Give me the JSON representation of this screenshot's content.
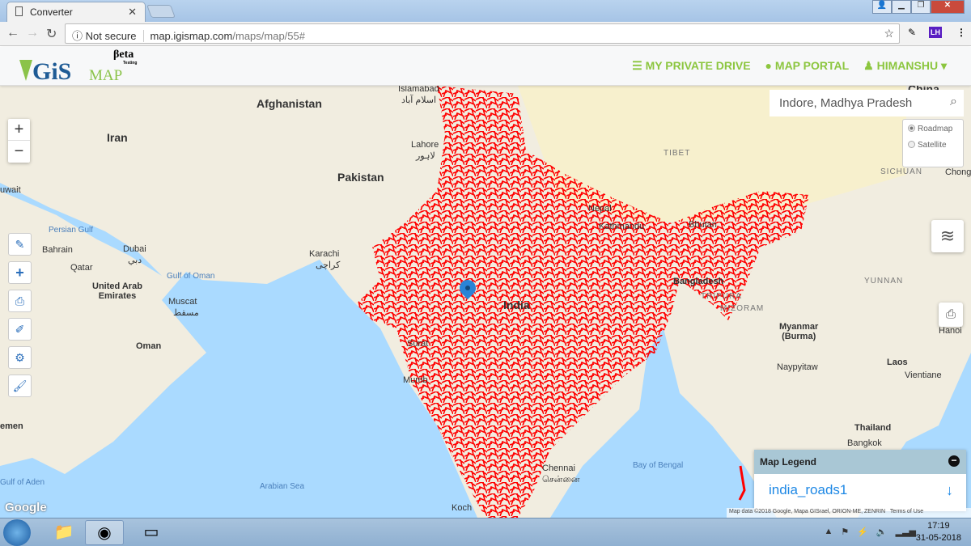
{
  "browser": {
    "tab_title": "Converter",
    "security": "Not secure",
    "url_host": "map.igismap.com",
    "url_path": "/maps/map/55#",
    "ext_badge": "LH"
  },
  "app": {
    "logo": {
      "gis": "GiS",
      "map": "MAP",
      "beta": "βeta",
      "testing": "Testing"
    },
    "nav": [
      {
        "label": "MY PRIVATE DRIVE",
        "icon": "database-icon"
      },
      {
        "label": "MAP PORTAL",
        "icon": "globe-icon"
      },
      {
        "label": "HIMANSHU",
        "icon": "user-icon"
      }
    ]
  },
  "map": {
    "search_value": "Indore, Madhya Pradesh",
    "zoom_in": "+",
    "zoom_out": "−",
    "map_types": [
      {
        "label": "Roadmap",
        "selected": true
      },
      {
        "label": "Satellite",
        "selected": false
      }
    ],
    "tools": [
      "pencil-icon",
      "plus-icon",
      "print-icon",
      "edit-icon",
      "cogs-icon",
      "brush-icon"
    ],
    "labels": {
      "afghanistan": "Afghanistan",
      "iran": "Iran",
      "pakistan": "Pakistan",
      "islamabad": "Islamabad",
      "islamabad_ur": "اسلام آباد",
      "lahore": "Lahore",
      "lahore_ur": "لاہور",
      "karachi": "Karachi",
      "karachi_ur": "کراچی",
      "kuwait": "uwait",
      "persian_gulf": "Persian Gulf",
      "bahrain": "Bahrain",
      "qatar": "Qatar",
      "dubai": "Dubai",
      "dubai_ar": "دبي",
      "uae": "United Arab\nEmirates",
      "gulf_oman": "Gulf of Oman",
      "muscat": "Muscat",
      "muscat_ar": "مسقط",
      "oman": "Oman",
      "yemen": "emen",
      "gulf_aden": "Gulf of Aden",
      "arabian_sea": "Arabian Sea",
      "india": "India",
      "nepal": "Nepal",
      "kathmandu": "Kathmandu",
      "bhutan": "Bhutan",
      "bangladesh": "Bangladesh",
      "tibet": "TIBET",
      "sichuan": "SICHUAN",
      "china": "China",
      "chong": "Chong",
      "yunnan": "YUNNAN",
      "myanmar": "Myanmar\n(Burma)",
      "naypyitaw": "Naypyitaw",
      "laos": "Laos",
      "vientiane": "Vientiane",
      "hanoi": "Hanoi",
      "thailand": "Thailand",
      "bangkok": "Bangkok",
      "bay_bengal": "Bay of Bengal",
      "chennai": "Chennai",
      "chennai_ta": "சென்னை",
      "mumbai": "Mumb",
      "surat": "Surat",
      "kochi": "Koch",
      "mizoram": "MIZORAM",
      "tripura": "TRIPURA"
    },
    "legend": {
      "title": "Map Legend",
      "layer": "india_roads1"
    },
    "attribution": "Map data ©2018 Google, Mapa GISrael, ORION-ME, ZENRIN",
    "terms": "Terms of Use",
    "google": "Google",
    "road_color": "#ff0000"
  },
  "taskbar": {
    "time": "17:19",
    "date": "31-05-2018"
  }
}
